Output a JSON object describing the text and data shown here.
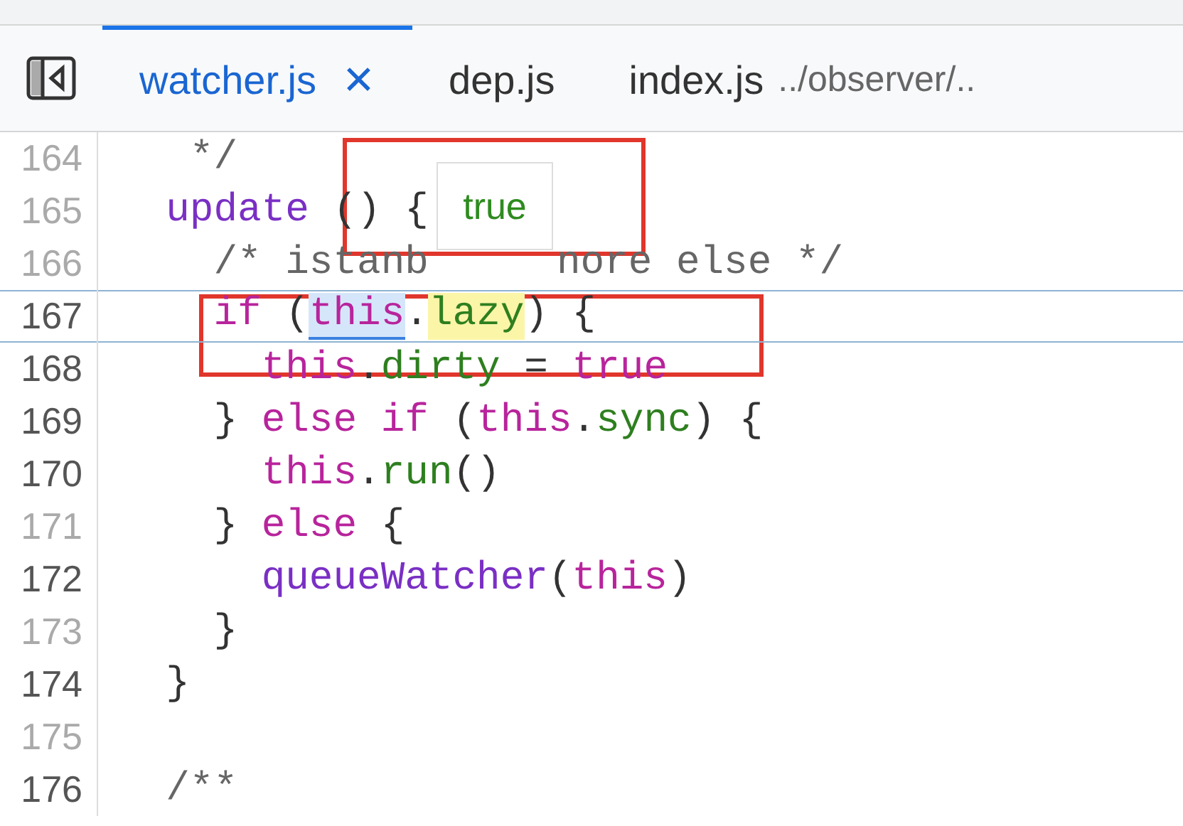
{
  "tabs": [
    {
      "label": "watcher.js",
      "selected": true,
      "closable": true,
      "close": "✕"
    },
    {
      "label": "dep.js",
      "selected": false,
      "closable": false
    },
    {
      "label": "index.js",
      "path": "../observer/..",
      "selected": false,
      "closable": false
    }
  ],
  "lines": [
    {
      "number": "164",
      "active": false,
      "current": false,
      "tokens": [
        {
          "text": "   */",
          "kind": "comment"
        }
      ]
    },
    {
      "number": "165",
      "active": false,
      "current": false,
      "tokens": [
        {
          "text": "  update",
          "kind": "fn"
        },
        {
          "text": " () {",
          "kind": "plain"
        }
      ]
    },
    {
      "number": "166",
      "active": false,
      "current": false,
      "tokens": [
        {
          "text": "    /* istanb",
          "kind": "comment"
        },
        {
          "text": "nore else */",
          "kind": "comment",
          "covered_before": true
        }
      ]
    },
    {
      "number": "167",
      "active": true,
      "current": true,
      "tokens": [
        {
          "text": "    if",
          "kind": "kw"
        },
        {
          "text": " (",
          "kind": "plain"
        },
        {
          "text": "this",
          "kind": "kw",
          "selection": true
        },
        {
          "text": ".",
          "kind": "plain"
        },
        {
          "text": "lazy",
          "kind": "prop",
          "match": true
        },
        {
          "text": ") {",
          "kind": "plain"
        }
      ]
    },
    {
      "number": "168",
      "active": true,
      "current": false,
      "tokens": [
        {
          "text": "      this",
          "kind": "kw"
        },
        {
          "text": ".",
          "kind": "plain"
        },
        {
          "text": "dirty",
          "kind": "prop"
        },
        {
          "text": " = ",
          "kind": "plain"
        },
        {
          "text": "true",
          "kind": "kw"
        }
      ]
    },
    {
      "number": "169",
      "active": true,
      "current": false,
      "tokens": [
        {
          "text": "    } ",
          "kind": "plain"
        },
        {
          "text": "else if",
          "kind": "kw"
        },
        {
          "text": " (",
          "kind": "plain"
        },
        {
          "text": "this",
          "kind": "kw"
        },
        {
          "text": ".",
          "kind": "plain"
        },
        {
          "text": "sync",
          "kind": "prop"
        },
        {
          "text": ") {",
          "kind": "plain"
        }
      ]
    },
    {
      "number": "170",
      "active": true,
      "current": false,
      "tokens": [
        {
          "text": "      this",
          "kind": "kw"
        },
        {
          "text": ".",
          "kind": "plain"
        },
        {
          "text": "run",
          "kind": "prop"
        },
        {
          "text": "()",
          "kind": "plain"
        }
      ]
    },
    {
      "number": "171",
      "active": false,
      "current": false,
      "tokens": [
        {
          "text": "    } ",
          "kind": "plain"
        },
        {
          "text": "else",
          "kind": "kw"
        },
        {
          "text": " {",
          "kind": "plain"
        }
      ]
    },
    {
      "number": "172",
      "active": true,
      "current": false,
      "tokens": [
        {
          "text": "      queueWatcher",
          "kind": "fn"
        },
        {
          "text": "(",
          "kind": "plain"
        },
        {
          "text": "this",
          "kind": "kw"
        },
        {
          "text": ")",
          "kind": "plain"
        }
      ]
    },
    {
      "number": "173",
      "active": false,
      "current": false,
      "tokens": [
        {
          "text": "    }",
          "kind": "plain"
        }
      ]
    },
    {
      "number": "174",
      "active": true,
      "current": false,
      "tokens": [
        {
          "text": "  }",
          "kind": "plain"
        }
      ]
    },
    {
      "number": "175",
      "active": false,
      "current": false
    },
    {
      "number": "176",
      "active": true,
      "current": false,
      "tokens": [
        {
          "text": "  /**",
          "kind": "comment"
        }
      ]
    }
  ],
  "tooltip": {
    "value": "true"
  }
}
